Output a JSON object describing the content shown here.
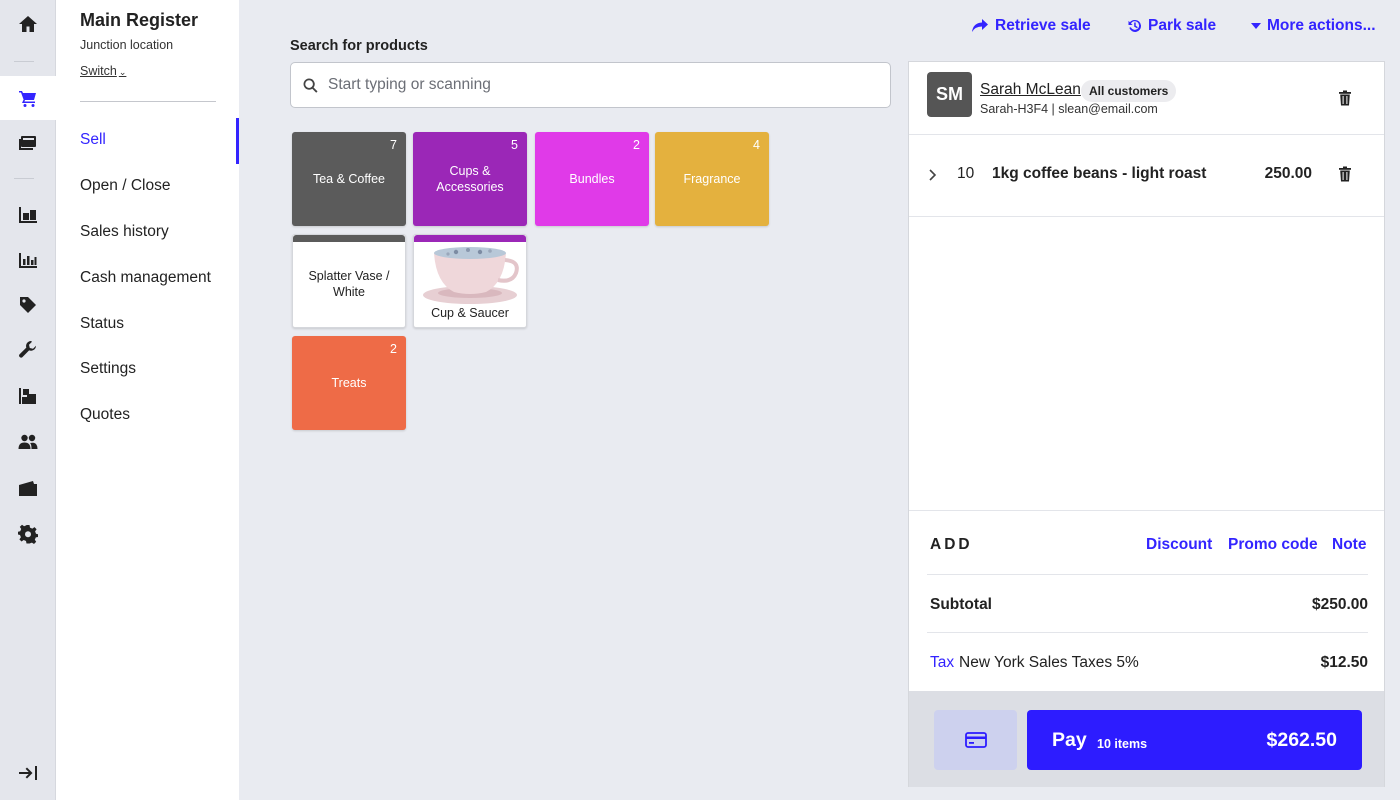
{
  "register": {
    "title": "Main Register",
    "location": "Junction location",
    "switch_label": "Switch"
  },
  "nav": {
    "items": [
      {
        "label": "Sell",
        "active": true
      },
      {
        "label": "Open / Close"
      },
      {
        "label": "Sales history"
      },
      {
        "label": "Cash management"
      },
      {
        "label": "Status"
      },
      {
        "label": "Settings"
      },
      {
        "label": "Quotes"
      }
    ]
  },
  "rail_icons": [
    "home-icon",
    "cart-icon",
    "register-icon",
    "inventory-icon",
    "reports-icon",
    "tag-icon",
    "wrench-icon",
    "products-icon",
    "customers-icon",
    "folder-icon",
    "gear-icon",
    "collapse-icon"
  ],
  "top_actions": {
    "retrieve": "Retrieve sale",
    "park": "Park sale",
    "more": "More actions..."
  },
  "search": {
    "label": "Search for products",
    "placeholder": "Start typing or scanning"
  },
  "tiles": [
    {
      "label": "Tea & Coffee",
      "count": "7",
      "color": "#5b5b5b"
    },
    {
      "label": "Cups & Accessories",
      "count": "5",
      "color": "#9b27b7"
    },
    {
      "label": "Bundles",
      "count": "2",
      "color": "#e03ae8"
    },
    {
      "label": "Fragrance",
      "count": "4",
      "color": "#e4b13e"
    },
    {
      "label": "Splatter Vase / White",
      "color": "#5b5b5b"
    },
    {
      "label": "Cup & Saucer",
      "color": "#9b27b7"
    },
    {
      "label": "Treats",
      "count": "2",
      "color": "#ee6b47"
    }
  ],
  "customer": {
    "initials": "SM",
    "name": "Sarah McLean",
    "group": "All customers",
    "details": "Sarah-H3F4 | slean@email.com"
  },
  "line_items": [
    {
      "qty": "10",
      "name": "1kg coffee beans - light roast",
      "price": "250.00"
    }
  ],
  "totals": {
    "add_label": "ADD",
    "discount": "Discount",
    "promo": "Promo code",
    "note": "Note",
    "subtotal_label": "Subtotal",
    "subtotal": "$250.00",
    "tax_link": "Tax",
    "tax_name": "New York Sales Taxes 5%",
    "tax": "$12.50"
  },
  "pay": {
    "label": "Pay",
    "items": "10 items",
    "total": "$262.50"
  },
  "colors": {
    "accent": "#3324ff",
    "pay_button": "#2d1cff"
  }
}
